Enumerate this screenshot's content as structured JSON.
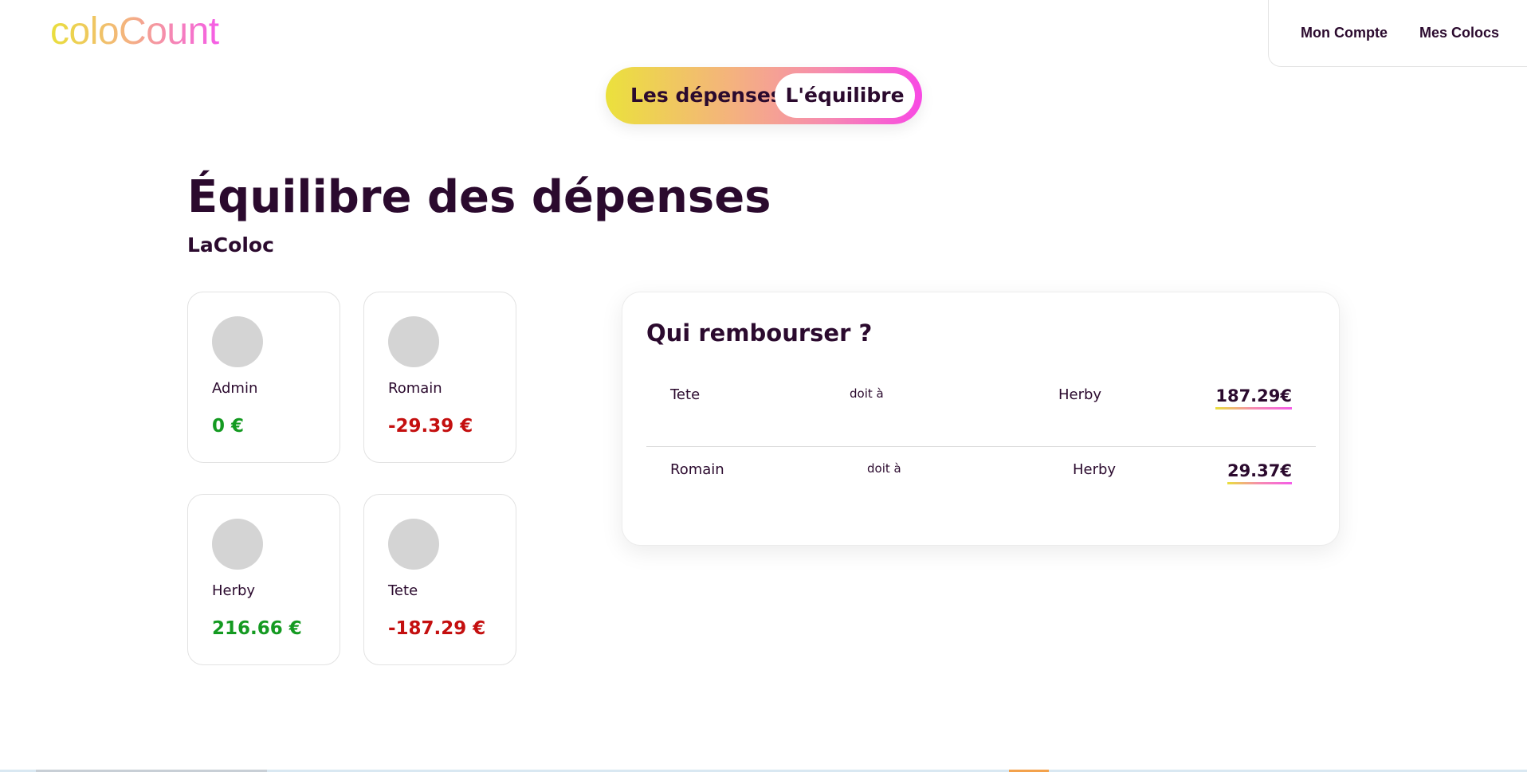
{
  "header": {
    "logo": "coloCount",
    "nav": [
      "Mon Compte",
      "Mes Colocs"
    ]
  },
  "toggle": {
    "left_label": "Les dépenses",
    "right_label": "L'équilibre",
    "active": "L'équilibre"
  },
  "page": {
    "title": "Équilibre des dépenses",
    "coloc": "LaColoc"
  },
  "members": [
    {
      "name": "Admin",
      "balance": "0 €",
      "status": "positive"
    },
    {
      "name": "Romain",
      "balance": "-29.39 €",
      "status": "negative"
    },
    {
      "name": "Herby",
      "balance": "216.66 €",
      "status": "positive"
    },
    {
      "name": "Tete",
      "balance": "-187.29 €",
      "status": "negative"
    }
  ],
  "reimburse": {
    "title": "Qui rembourser ?",
    "rows": [
      {
        "from": "Tete",
        "verb": "doit à",
        "to": "Herby",
        "amount": "187.29€"
      },
      {
        "from": "Romain",
        "verb": "doit à",
        "to": "Herby",
        "amount": "29.37€"
      }
    ]
  },
  "colors": {
    "text": "#2b0a2e",
    "positive": "#149a21",
    "negative": "#c40f0f",
    "gradient_start": "#e9df3c",
    "gradient_end": "#f55ce8"
  }
}
